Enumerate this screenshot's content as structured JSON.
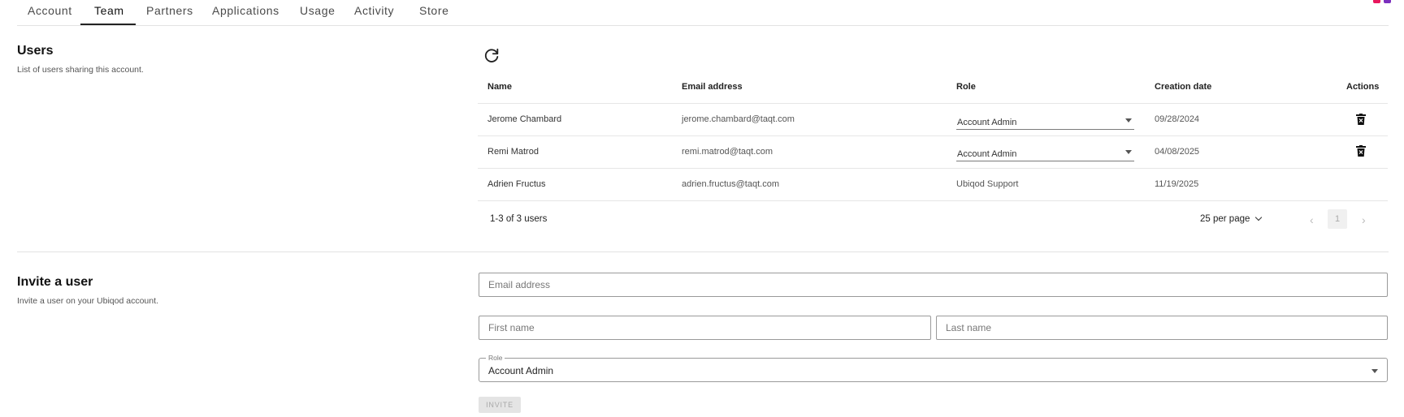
{
  "tabs": [
    {
      "label": "Account"
    },
    {
      "label": "Team",
      "active": true
    },
    {
      "label": "Partners"
    },
    {
      "label": "Applications"
    },
    {
      "label": "Usage"
    },
    {
      "label": "Activity"
    },
    {
      "label": "Store"
    }
  ],
  "users_section": {
    "title": "Users",
    "description": "List of users sharing this account."
  },
  "table": {
    "headers": {
      "name": "Name",
      "email": "Email address",
      "role": "Role",
      "creation_date": "Creation date",
      "actions": "Actions"
    },
    "rows": [
      {
        "name": "Jerome Chambard",
        "email": "jerome.chambard@taqt.com",
        "role": "Account Admin",
        "role_editable": true,
        "creation_date": "09/28/2024",
        "deletable": true
      },
      {
        "name": "Remi Matrod",
        "email": "remi.matrod@taqt.com",
        "role": "Account Admin",
        "role_editable": true,
        "creation_date": "04/08/2025",
        "deletable": true
      },
      {
        "name": "Adrien Fructus",
        "email": "adrien.fructus@taqt.com",
        "role": "Ubiqod Support",
        "role_editable": false,
        "creation_date": "11/19/2025",
        "deletable": false
      }
    ],
    "pagination": {
      "count_label": "1-3 of 3 users",
      "per_page_label": "25 per page",
      "current_page": "1"
    }
  },
  "invite_section": {
    "title": "Invite a user",
    "description": "Invite a user on your Ubiqod account.",
    "email_placeholder": "Email address",
    "first_name_placeholder": "First name",
    "last_name_placeholder": "Last name",
    "role_label": "Role",
    "role_value": "Account Admin",
    "invite_button": "INVITE"
  },
  "colors": {
    "tab_active_underline": "#222222",
    "corner_marks": [
      "#e8175d",
      "#7b2fbe"
    ],
    "disabled_button": "#e4e4e4"
  },
  "icons": {
    "refresh": "refresh-icon",
    "delete": "trash-icon",
    "prev_page": "chevron-left-icon",
    "next_page": "chevron-right-icon"
  }
}
